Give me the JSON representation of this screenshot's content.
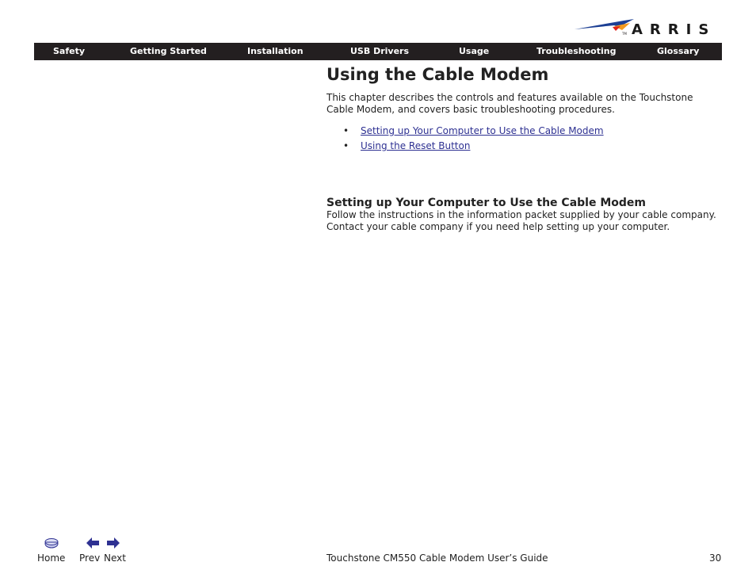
{
  "brand": {
    "logo_text": "ARRIS",
    "trademark": "TM",
    "colors": {
      "blue": "#1c3f94",
      "orange": "#f39a1e",
      "red": "#e2231a",
      "dark": "#231f20"
    }
  },
  "nav": {
    "items": [
      {
        "label": "Safety"
      },
      {
        "label": "Getting Started"
      },
      {
        "label": "Installation"
      },
      {
        "label": "USB Drivers"
      },
      {
        "label": "Usage"
      },
      {
        "label": "Troubleshooting"
      },
      {
        "label": "Glossary"
      }
    ]
  },
  "content": {
    "title": "Using the Cable Modem",
    "intro": "This chapter describes the controls and features available on the Touchstone Cable Modem, and covers basic troubleshooting procedures.",
    "links": [
      {
        "label": "Setting up Your Computer to Use the Cable Modem"
      },
      {
        "label": "Using the Reset Button"
      }
    ],
    "section": {
      "heading": "Setting up Your Computer to Use the Cable Modem",
      "text": "Follow the instructions in the information packet supplied by your cable company. Contact your cable company if you need help setting up your computer."
    },
    "link_color": "#2e3192"
  },
  "footer": {
    "home_label": "Home",
    "prev_label": "Prev",
    "next_label": "Next",
    "icons": {
      "home": "home-icon",
      "prev": "arrow-left-icon",
      "next": "arrow-right-icon"
    },
    "doc_title": "Touchstone CM550 Cable Modem User’s Guide",
    "page_number": "30"
  }
}
